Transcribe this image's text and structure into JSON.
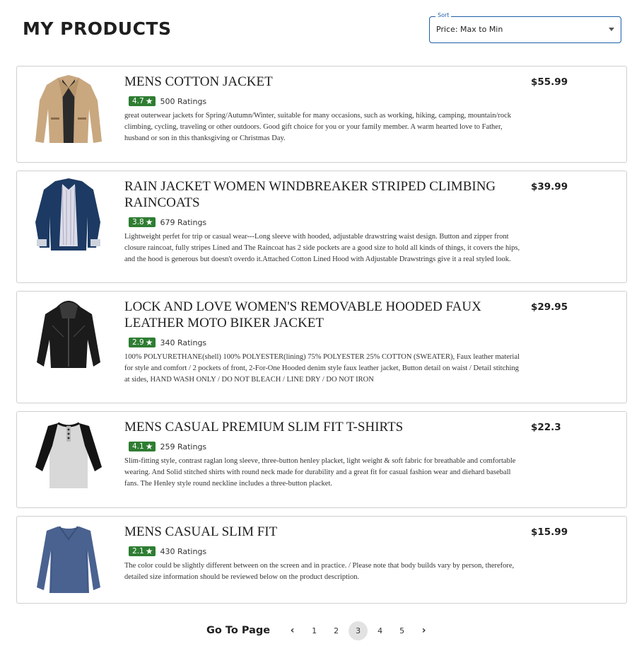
{
  "header": {
    "title": "MY PRODUCTS",
    "sort": {
      "legend": "Sort",
      "value": "Price: Max to Min"
    }
  },
  "products": [
    {
      "name": "MENS COTTON JACKET",
      "rating": "4.7",
      "ratings_label": "500 Ratings",
      "description": "great outerwear jackets for Spring/Autumn/Winter, suitable for many occasions, such as working, hiking, camping, mountain/rock climbing, cycling, traveling or other outdoors. Good gift choice for you or your family member. A warm hearted love to Father, husband or son in this thanksgiving or Christmas Day.",
      "price": "$55.99",
      "image": "tan-cotton-jacket"
    },
    {
      "name": "RAIN JACKET WOMEN WINDBREAKER STRIPED CLIMBING RAINCOATS",
      "rating": "3.8",
      "ratings_label": "679 Ratings",
      "description": "Lightweight perfet for trip or casual wear---Long sleeve with hooded, adjustable drawstring waist design. Button and zipper front closure raincoat, fully stripes Lined and The Raincoat has 2 side pockets are a good size to hold all kinds of things, it covers the hips, and the hood is generous but doesn't overdo it.Attached Cotton Lined Hood with Adjustable Drawstrings give it a real styled look.",
      "price": "$39.99",
      "image": "navy-rain-jacket"
    },
    {
      "name": "LOCK AND LOVE WOMEN'S REMOVABLE HOODED FAUX LEATHER MOTO BIKER JACKET",
      "rating": "2.9",
      "ratings_label": "340 Ratings",
      "description": "100% POLYURETHANE(shell) 100% POLYESTER(lining) 75% POLYESTER 25% COTTON (SWEATER), Faux leather material for style and comfort / 2 pockets of front, 2-For-One Hooded denim style faux leather jacket, Button detail on waist / Detail stitching at sides, HAND WASH ONLY / DO NOT BLEACH / LINE DRY / DO NOT IRON",
      "price": "$29.95",
      "image": "black-leather-jacket"
    },
    {
      "name": "MENS CASUAL PREMIUM SLIM FIT T-SHIRTS",
      "rating": "4.1",
      "ratings_label": "259 Ratings",
      "description": "Slim-fitting style, contrast raglan long sleeve, three-button henley placket, light weight & soft fabric for breathable and comfortable wearing. And Solid stitched shirts with round neck made for durability and a great fit for casual fashion wear and diehard baseball fans. The Henley style round neckline includes a three-button placket.",
      "price": "$22.3",
      "image": "raglan-henley-shirt"
    },
    {
      "name": "MENS CASUAL SLIM FIT",
      "rating": "2.1",
      "ratings_label": "430 Ratings",
      "description": "The color could be slightly different between on the screen and in practice. / Please note that body builds vary by person, therefore, detailed size information should be reviewed below on the product description.",
      "price": "$15.99",
      "image": "blue-longsleeve-shirt"
    }
  ],
  "pagination": {
    "label": "Go To Page",
    "prev_icon": "chevron-left-icon",
    "next_icon": "chevron-right-icon",
    "pages": [
      "1",
      "2",
      "3",
      "4",
      "5"
    ],
    "current": "3"
  },
  "colors": {
    "rating_badge": "#2e7d32",
    "sort_border": "#1d5fa8"
  }
}
